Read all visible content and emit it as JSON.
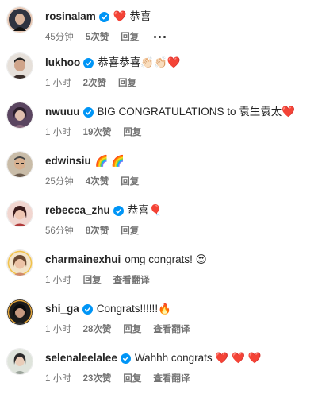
{
  "comments": [
    {
      "username": "rosinalam",
      "text": "❤️ 恭喜",
      "time": "45分钟",
      "likes": "5次赞",
      "reply": "回复",
      "more": "更多",
      "avatar_color": "#2f3340"
    },
    {
      "username": "lukhoo",
      "text": "恭喜恭喜👏🏻👏🏻❤️",
      "time": "1 小时",
      "likes": "2次赞",
      "reply": "回复",
      "avatar_color": "#4a3c36"
    },
    {
      "username": "nwuuu",
      "text": "BIG CONGRATULATIONS to 袁生袁太❤️",
      "time": "1 小时",
      "likes": "19次赞",
      "reply": "回复",
      "avatar_color": "#7a5a70"
    },
    {
      "username": "edwinsiu",
      "text": "🌈 🌈",
      "time": "25分钟",
      "likes": "4次赞",
      "reply": "回复",
      "avatar_color": "#8a7a6a"
    },
    {
      "username": "rebecca_zhu",
      "text": "恭喜🎈",
      "time": "56分钟",
      "likes": "8次赞",
      "reply": "回复",
      "avatar_color": "#b26a6a"
    },
    {
      "username": "charmainexhui",
      "text": "omg congrats! 😍",
      "time": "1 小时",
      "reply": "回复",
      "translate": "查看翻译",
      "avatar_color": "#d8b08a"
    },
    {
      "username": "shi_ga",
      "text": "Congrats!!!!!!🔥",
      "time": "1 小时",
      "likes": "28次赞",
      "reply": "回复",
      "translate": "查看翻译",
      "avatar_color": "#2a2a2a"
    },
    {
      "username": "selenaleelalee",
      "text": "Wahhh congrats ❤️ ❤️ ❤️",
      "time": "1 小时",
      "likes": "23次赞",
      "reply": "回复",
      "translate": "查看翻译",
      "avatar_color": "#c9cfc4"
    }
  ],
  "colors": {
    "verified": "#0095f6",
    "meta": "#737373",
    "text": "#262626"
  },
  "icons": {
    "verified": "verified-badge-icon",
    "more": "more-dots-icon"
  }
}
